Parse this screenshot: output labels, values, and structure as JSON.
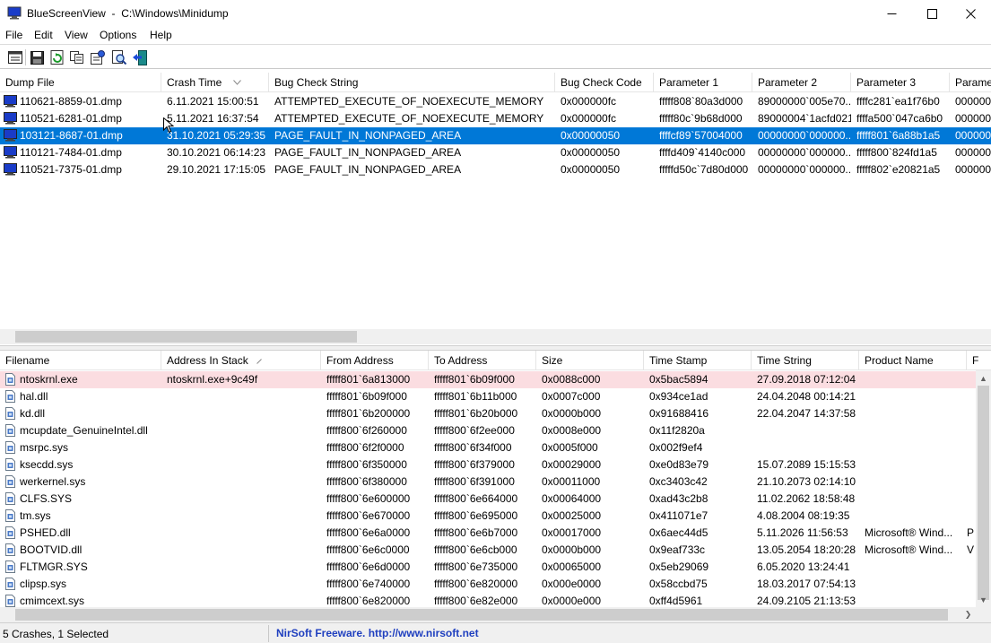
{
  "window": {
    "app_name": "BlueScreenView",
    "path": "C:\\Windows\\Minidump"
  },
  "menu": [
    "File",
    "Edit",
    "View",
    "Options",
    "Help"
  ],
  "toolbar_icons": [
    "properties-icon",
    "save-icon",
    "refresh-icon",
    "copy-icon",
    "html-report-icon",
    "find-icon",
    "exit-icon"
  ],
  "top_table": {
    "columns": [
      "Dump File",
      "Crash Time",
      "Bug Check String",
      "Bug Check Code",
      "Parameter 1",
      "Parameter 2",
      "Parameter 3",
      "Paramete"
    ],
    "sort_column": "Crash Time",
    "rows": [
      [
        "110621-8859-01.dmp",
        "6.11.2021 15:00:51",
        "ATTEMPTED_EXECUTE_OF_NOEXECUTE_MEMORY",
        "0x000000fc",
        "fffff808`80a3d000",
        "89000000`005e70...",
        "ffffc281`ea1f76b0",
        "0000000"
      ],
      [
        "110521-6281-01.dmp",
        "5.11.2021 16:37:54",
        "ATTEMPTED_EXECUTE_OF_NOEXECUTE_MEMORY",
        "0x000000fc",
        "fffff80c`9b68d000",
        "89000004`1acfd021",
        "ffffa500`047ca6b0",
        "0000000"
      ],
      [
        "103121-8687-01.dmp",
        "31.10.2021 05:29:35",
        "PAGE_FAULT_IN_NONPAGED_AREA",
        "0x00000050",
        "ffffcf89`57004000",
        "00000000`000000...",
        "fffff801`6a88b1a5",
        "0000000"
      ],
      [
        "110121-7484-01.dmp",
        "30.10.2021 06:14:23",
        "PAGE_FAULT_IN_NONPAGED_AREA",
        "0x00000050",
        "ffffd409`4140c000",
        "00000000`000000...",
        "fffff800`824fd1a5",
        "0000000"
      ],
      [
        "110521-7375-01.dmp",
        "29.10.2021 17:15:05",
        "PAGE_FAULT_IN_NONPAGED_AREA",
        "0x00000050",
        "fffffd50c`7d80d000",
        "00000000`000000...",
        "fffff802`e20821a5",
        "0000000"
      ]
    ],
    "selected_index": 2
  },
  "bottom_table": {
    "columns": [
      "Filename",
      "Address In Stack",
      "From Address",
      "To Address",
      "Size",
      "Time Stamp",
      "Time String",
      "Product Name",
      "F"
    ],
    "sort_column": "Address In Stack",
    "highlight_index": 0,
    "rows": [
      [
        "ntoskrnl.exe",
        "ntoskrnl.exe+9c49f",
        "fffff801`6a813000",
        "fffff801`6b09f000",
        "0x0088c000",
        "0x5bac5894",
        "27.09.2018 07:12:04",
        "",
        ""
      ],
      [
        "hal.dll",
        "",
        "fffff801`6b09f000",
        "fffff801`6b11b000",
        "0x0007c000",
        "0x934ce1ad",
        "24.04.2048 00:14:21",
        "",
        ""
      ],
      [
        "kd.dll",
        "",
        "fffff801`6b200000",
        "fffff801`6b20b000",
        "0x0000b000",
        "0x91688416",
        "22.04.2047 14:37:58",
        "",
        ""
      ],
      [
        "mcupdate_GenuineIntel.dll",
        "",
        "fffff800`6f260000",
        "fffff800`6f2ee000",
        "0x0008e000",
        "0x11f2820a",
        "",
        "",
        ""
      ],
      [
        "msrpc.sys",
        "",
        "fffff800`6f2f0000",
        "fffff800`6f34f000",
        "0x0005f000",
        "0x002f9ef4",
        "",
        "",
        ""
      ],
      [
        "ksecdd.sys",
        "",
        "fffff800`6f350000",
        "fffff800`6f379000",
        "0x00029000",
        "0xe0d83e79",
        "15.07.2089 15:15:53",
        "",
        ""
      ],
      [
        "werkernel.sys",
        "",
        "fffff800`6f380000",
        "fffff800`6f391000",
        "0x00011000",
        "0xc3403c42",
        "21.10.2073 02:14:10",
        "",
        ""
      ],
      [
        "CLFS.SYS",
        "",
        "fffff800`6e600000",
        "fffff800`6e664000",
        "0x00064000",
        "0xad43c2b8",
        "11.02.2062 18:58:48",
        "",
        ""
      ],
      [
        "tm.sys",
        "",
        "fffff800`6e670000",
        "fffff800`6e695000",
        "0x00025000",
        "0x411071e7",
        "4.08.2004 08:19:35",
        "",
        ""
      ],
      [
        "PSHED.dll",
        "",
        "fffff800`6e6a0000",
        "fffff800`6e6b7000",
        "0x00017000",
        "0x6aec44d5",
        "5.11.2026 11:56:53",
        "Microsoft® Wind...",
        "P"
      ],
      [
        "BOOTVID.dll",
        "",
        "fffff800`6e6c0000",
        "fffff800`6e6cb000",
        "0x0000b000",
        "0x9eaf733c",
        "13.05.2054 18:20:28",
        "Microsoft® Wind...",
        "V"
      ],
      [
        "FLTMGR.SYS",
        "",
        "fffff800`6e6d0000",
        "fffff800`6e735000",
        "0x00065000",
        "0x5eb29069",
        "6.05.2020 13:24:41",
        "",
        ""
      ],
      [
        "clipsp.sys",
        "",
        "fffff800`6e740000",
        "fffff800`6e820000",
        "0x000e0000",
        "0x58ccbd75",
        "18.03.2017 07:54:13",
        "",
        ""
      ],
      [
        "cmimcext.sys",
        "",
        "fffff800`6e820000",
        "fffff800`6e82e000",
        "0x0000e000",
        "0xff4d5961",
        "24.09.2105 21:13:53",
        "",
        ""
      ]
    ]
  },
  "status": {
    "left": "5 Crashes, 1 Selected",
    "right": "NirSoft Freeware.  http://www.nirsoft.net"
  },
  "colors": {
    "selection": "#0078d7",
    "highlight_row": "#fbdde1",
    "link": "#1f3fbf"
  }
}
